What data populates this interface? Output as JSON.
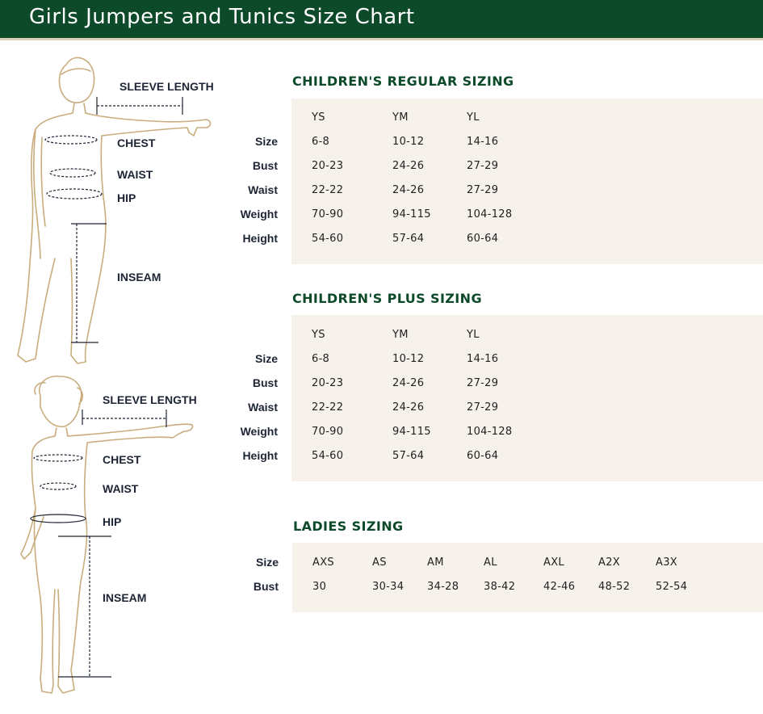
{
  "header": {
    "title": "Girls Jumpers and Tunics Size Chart",
    "bg_color": "#0d4a2a"
  },
  "figure_top": {
    "labels": {
      "sleeve": "SLEEVE LENGTH",
      "chest": "CHEST",
      "waist": "WAIST",
      "hip": "HIP",
      "inseam": "INSEAM"
    }
  },
  "figure_bottom": {
    "labels": {
      "sleeve": "SLEEVE LENGTH",
      "chest": "CHEST",
      "waist": "WAIST",
      "hip": "HIP",
      "inseam": "INSEAM"
    }
  },
  "regular": {
    "title": "CHILDREN'S REGULAR SIZING",
    "columns": [
      "YS",
      "YM",
      "YL"
    ],
    "rows": [
      {
        "label": "Size",
        "values": [
          "6-8",
          "10-12",
          "14-16"
        ]
      },
      {
        "label": "Bust",
        "values": [
          "20-23",
          "24-26",
          "27-29"
        ]
      },
      {
        "label": "Waist",
        "values": [
          "22-22",
          "24-26",
          "27-29"
        ]
      },
      {
        "label": "Weight",
        "values": [
          "70-90",
          "94-115",
          "104-128"
        ]
      },
      {
        "label": "Height",
        "values": [
          "54-60",
          "57-64",
          "60-64"
        ]
      }
    ]
  },
  "plus": {
    "title": "CHILDREN'S PLUS SIZING",
    "columns": [
      "YS",
      "YM",
      "YL"
    ],
    "rows": [
      {
        "label": "Size",
        "values": [
          "6-8",
          "10-12",
          "14-16"
        ]
      },
      {
        "label": "Bust",
        "values": [
          "20-23",
          "24-26",
          "27-29"
        ]
      },
      {
        "label": "Waist",
        "values": [
          "22-22",
          "24-26",
          "27-29"
        ]
      },
      {
        "label": "Weight",
        "values": [
          "70-90",
          "94-115",
          "104-128"
        ]
      },
      {
        "label": "Height",
        "values": [
          "54-60",
          "57-64",
          "60-64"
        ]
      }
    ]
  },
  "ladies": {
    "title": "LADIES SIZING",
    "rows": [
      {
        "label": "Size",
        "values": [
          "AXS",
          "AS",
          "AM",
          "AL",
          "AXL",
          "A2X",
          "A3X"
        ]
      },
      {
        "label": "Bust",
        "values": [
          "30",
          "30-34",
          "34-28",
          "38-42",
          "42-46",
          "48-52",
          "52-54"
        ]
      }
    ]
  }
}
